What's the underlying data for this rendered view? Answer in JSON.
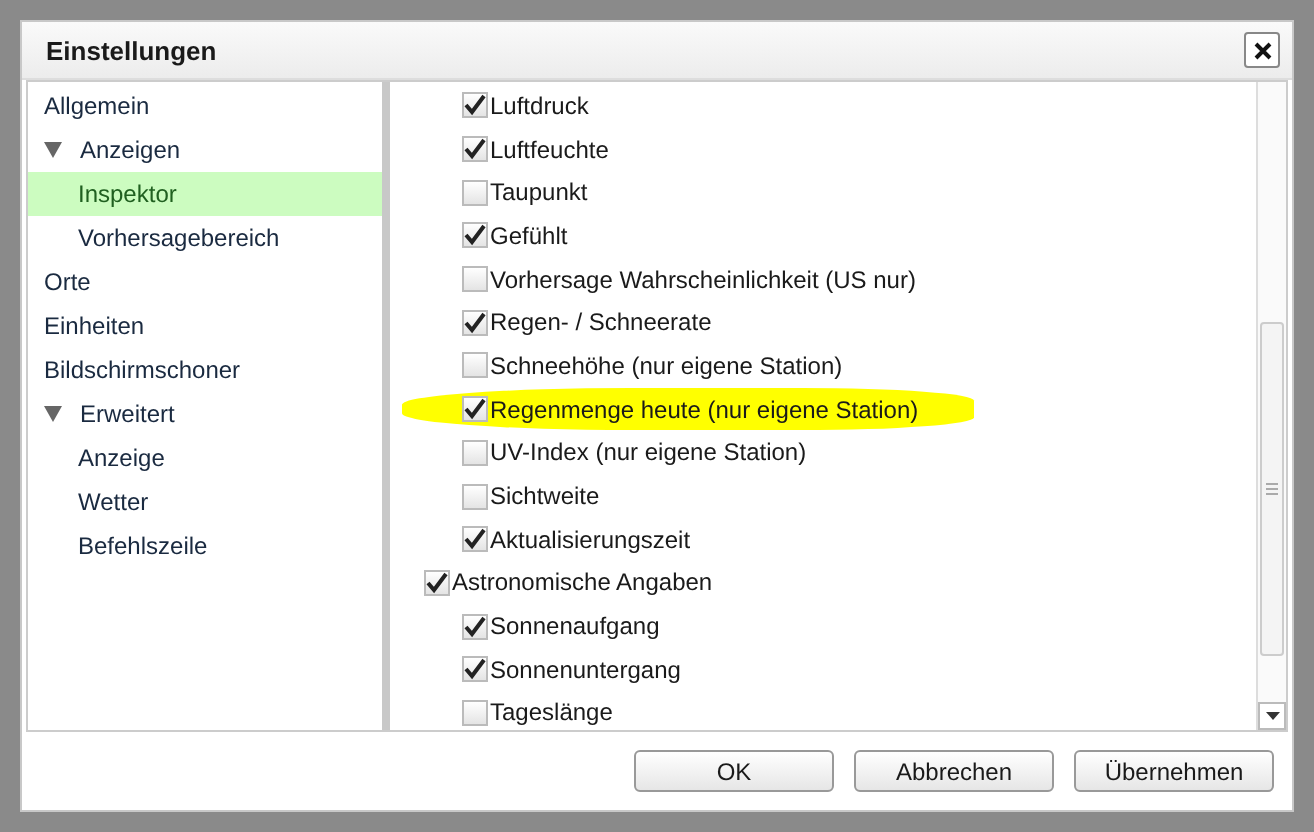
{
  "window": {
    "title": "Einstellungen"
  },
  "sidebar": {
    "items": [
      {
        "label": "Allgemein",
        "selected": false
      },
      {
        "label": "Anzeigen",
        "selected": false,
        "expanded": true,
        "children": [
          {
            "label": "Inspektor",
            "selected": true
          },
          {
            "label": "Vorhersagebereich",
            "selected": false
          }
        ]
      },
      {
        "label": "Orte",
        "selected": false
      },
      {
        "label": "Einheiten",
        "selected": false
      },
      {
        "label": "Bildschirmschoner",
        "selected": false
      },
      {
        "label": "Erweitert",
        "selected": false,
        "expanded": true,
        "children": [
          {
            "label": "Anzeige",
            "selected": false
          },
          {
            "label": "Wetter",
            "selected": false
          },
          {
            "label": "Befehlszeile",
            "selected": false
          }
        ]
      }
    ]
  },
  "option_groups": [
    {
      "children": [
        {
          "label": "Luftdruck",
          "checked": true,
          "highlighted": false
        },
        {
          "label": "Luftfeuchte",
          "checked": true,
          "highlighted": false
        },
        {
          "label": "Taupunkt",
          "checked": false,
          "highlighted": false
        },
        {
          "label": "Gefühlt",
          "checked": true,
          "highlighted": false
        },
        {
          "label": "Vorhersage Wahrscheinlichkeit (US nur)",
          "checked": false,
          "highlighted": false
        },
        {
          "label": "Regen- / Schneerate",
          "checked": true,
          "highlighted": false
        },
        {
          "label": "Schneehöhe (nur eigene Station)",
          "checked": false,
          "highlighted": false
        },
        {
          "label": "Regenmenge heute (nur eigene Station)",
          "checked": true,
          "highlighted": true
        },
        {
          "label": "UV-Index (nur eigene Station)",
          "checked": false,
          "highlighted": false
        },
        {
          "label": "Sichtweite",
          "checked": false,
          "highlighted": false
        },
        {
          "label": "Aktualisierungszeit",
          "checked": true,
          "highlighted": false
        }
      ]
    },
    {
      "label": "Astronomische Angaben",
      "checked": true,
      "children": [
        {
          "label": "Sonnenaufgang",
          "checked": true,
          "highlighted": false
        },
        {
          "label": "Sonnenuntergang",
          "checked": true,
          "highlighted": false
        },
        {
          "label": "Tageslänge",
          "checked": false,
          "highlighted": false
        }
      ]
    }
  ],
  "buttons": [
    "OK",
    "Abbrechen",
    "Übernehmen"
  ]
}
